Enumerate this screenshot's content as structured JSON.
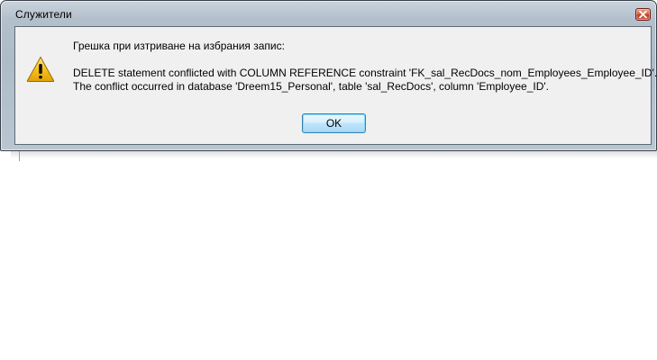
{
  "window": {
    "title": "Служители",
    "close_icon": "close-icon"
  },
  "message": {
    "icon": "warning-icon",
    "heading": "Грешка при изтриване на избрания запис:",
    "line1": "DELETE statement conflicted with COLUMN REFERENCE constraint 'FK_sal_RecDocs_nom_Employees_Employee_ID'.",
    "line2": "The conflict occurred in database 'Dreem15_Personal', table 'sal_RecDocs', column 'Employee_ID'."
  },
  "buttons": {
    "ok_label": "OK"
  },
  "colors": {
    "close_button": "#c0392b",
    "warning_yellow": "#f7c21a",
    "ok_border": "#3c7fb1"
  }
}
